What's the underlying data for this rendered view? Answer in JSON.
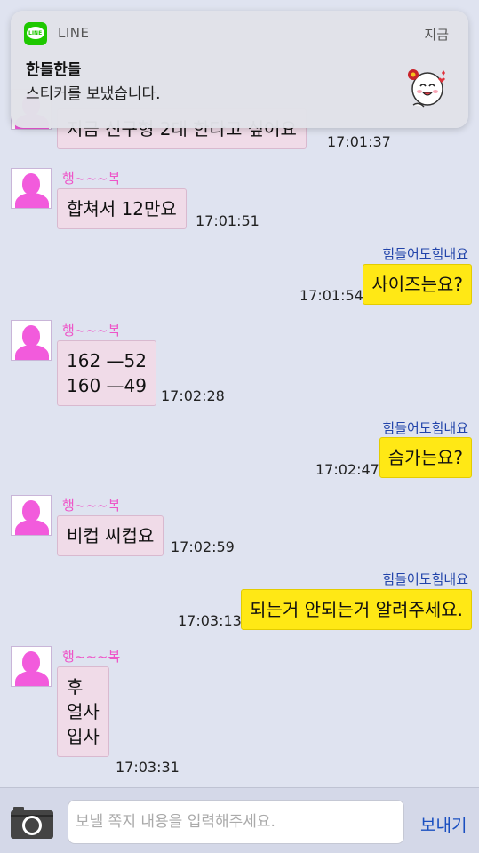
{
  "notification": {
    "app_name": "LINE",
    "time": "지금",
    "title": "한들한들",
    "body": "스티커를 보냈습니다.",
    "icon_text": "LINE"
  },
  "messages": [
    {
      "from": "in",
      "text": "지금 신구형 2대 한다고 싶어요",
      "time": "17:01:37"
    },
    {
      "from": "in",
      "sender": "행~~~복",
      "text": "합쳐서 12만요",
      "time": "17:01:51"
    },
    {
      "from": "out",
      "sender": "힘들어도힘내요",
      "text": "사이즈는요?",
      "time": "17:01:54"
    },
    {
      "from": "in",
      "sender": "행~~~복",
      "text": "162 —52\n160 —49",
      "time": "17:02:28"
    },
    {
      "from": "out",
      "sender": "힘들어도힘내요",
      "text": "슴가는요?",
      "time": "17:02:47"
    },
    {
      "from": "in",
      "sender": "행~~~복",
      "text": "비컵 씨컵요",
      "time": "17:02:59"
    },
    {
      "from": "out",
      "sender": "힘들어도힘내요",
      "text": "되는거 안되는거 알려주세요.",
      "time": "17:03:13"
    },
    {
      "from": "in",
      "sender": "행~~~복",
      "text": "후\n얼사\n입사",
      "time": "17:03:31"
    }
  ],
  "input": {
    "placeholder": "보낼 쪽지 내용을 입력해주세요.",
    "send_label": "보내기"
  },
  "colors": {
    "background": "#dfe3f0",
    "incoming_bubble": "#f0dbe8",
    "outgoing_bubble": "#ffe815",
    "sender_in": "#ee55c8",
    "sender_out": "#2244aa",
    "send_button": "#1a4fc0"
  },
  "icons": [
    "line-app-icon",
    "sticker-icon",
    "avatar-icon",
    "camera-icon"
  ]
}
